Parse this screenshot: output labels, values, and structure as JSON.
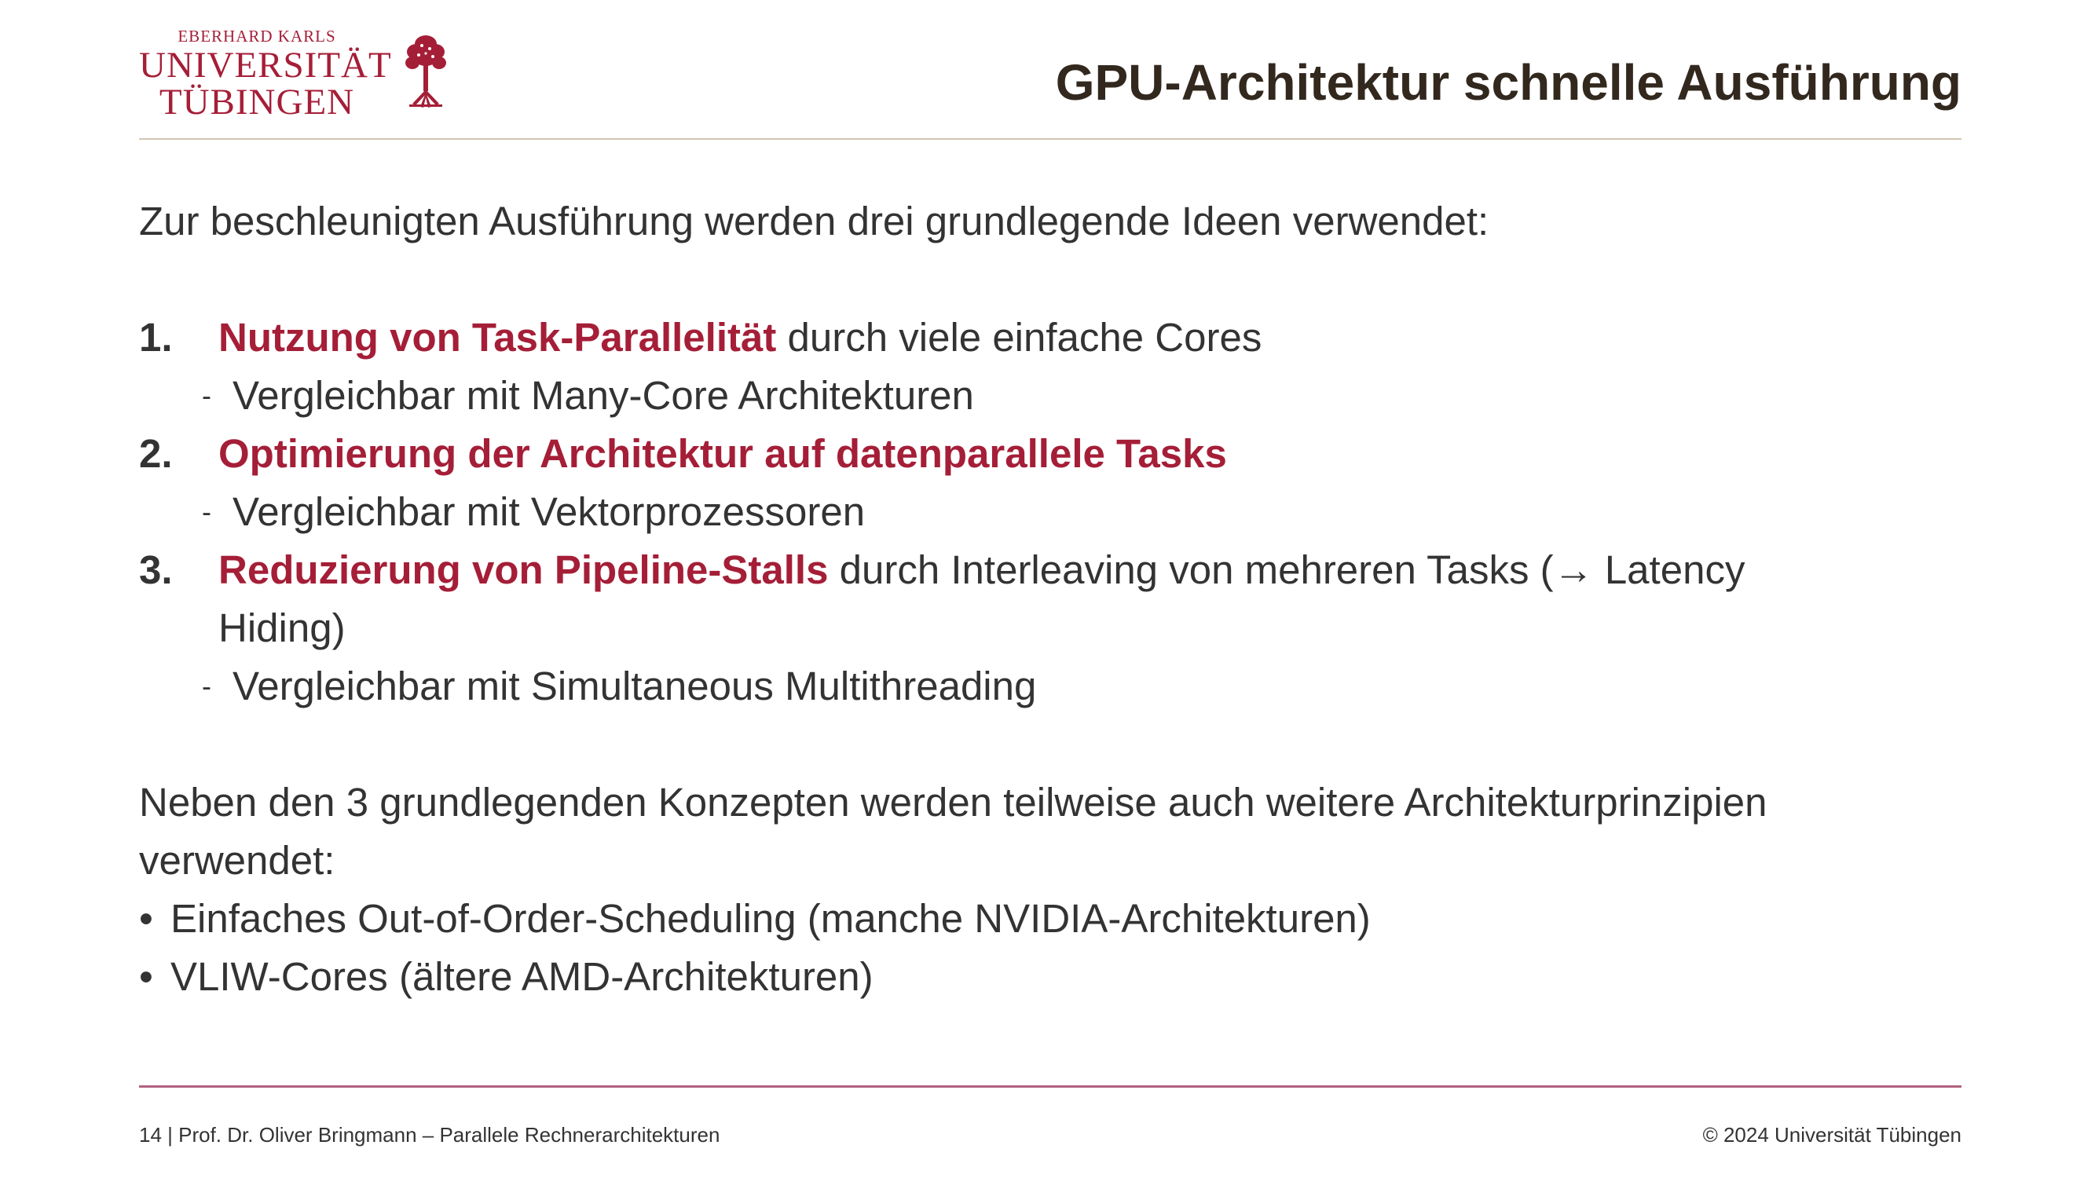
{
  "logo": {
    "line1": "EBERHARD KARLS",
    "line2": "UNIVERSITÄT",
    "line3": "TÜBINGEN"
  },
  "header": {
    "title": "GPU-Architektur schnelle Ausführung"
  },
  "body": {
    "intro": "Zur beschleunigten Ausführung werden drei grundlegende Ideen verwendet:",
    "items": [
      {
        "number": "1.",
        "highlight": "Nutzung von Task-Parallelität",
        "rest": " durch viele einfache Cores",
        "continuation": "",
        "sub": "Vergleichbar mit Many-Core Architekturen"
      },
      {
        "number": "2.",
        "highlight": "Optimierung der Architektur auf datenparallele Tasks",
        "rest": "",
        "continuation": "",
        "sub": "Vergleichbar mit Vektorprozessoren"
      },
      {
        "number": "3.",
        "highlight": "Reduzierung von Pipeline-Stalls",
        "rest": " durch Interleaving von mehreren Tasks (→ Latency",
        "continuation": "Hiding)",
        "sub": "Vergleichbar mit Simultaneous Multithreading"
      }
    ],
    "sub_marker": "-",
    "paragraph_line1": "Neben den 3 grundlegenden Konzepten werden teilweise auch weitere Architekturprinzipien",
    "paragraph_line2": "verwendet:",
    "bullet_marker": "•",
    "bullets": [
      "Einfaches Out-of-Order-Scheduling (manche NVIDIA-Architekturen)",
      "VLIW-Cores (ältere AMD-Architekturen)"
    ]
  },
  "footer": {
    "left": "14 | Prof. Dr. Oliver Bringmann – Parallele Rechnerarchitekturen",
    "right": "© 2024 Universität Tübingen"
  },
  "colors": {
    "accent_red": "#a51e37",
    "title": "#32281e",
    "text": "#333333",
    "rule_top": "#d3c5b4",
    "rule_bottom": "#b06180"
  }
}
